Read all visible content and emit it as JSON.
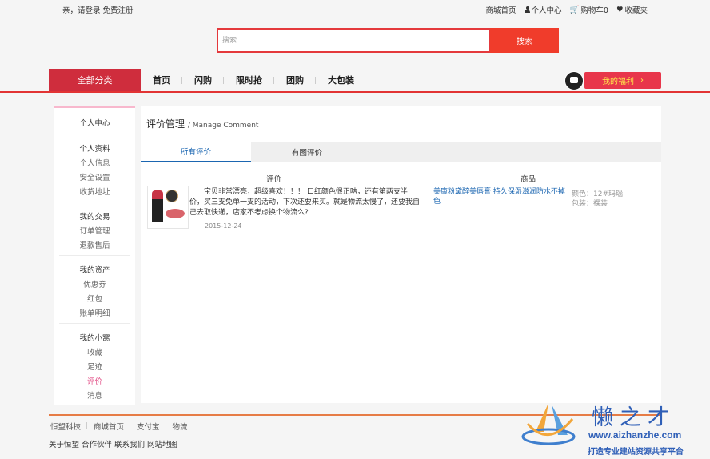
{
  "top": {
    "greeting": "亲，请登录",
    "register": "免费注册",
    "links": [
      "商城首页",
      "个人中心",
      "购物车0",
      "收藏夹"
    ]
  },
  "search": {
    "placeholder": "搜索",
    "button": "搜索"
  },
  "nav": {
    "all_categories": "全部分类",
    "links": [
      "首页",
      "闪购",
      "限时抢",
      "团购",
      "大包装"
    ],
    "welfare": "我的福利"
  },
  "sidebar": {
    "title": "个人中心",
    "groups": [
      {
        "head": "个人资料",
        "items": [
          "个人信息",
          "安全设置",
          "收货地址"
        ]
      },
      {
        "head": "我的交易",
        "items": [
          "订单管理",
          "退款售后"
        ]
      },
      {
        "head": "我的资产",
        "items": [
          "优惠券",
          "红包",
          "账单明细"
        ]
      },
      {
        "head": "我的小窝",
        "items": [
          "收藏",
          "足迹",
          "评价",
          "消息"
        ]
      }
    ],
    "active": "评价"
  },
  "main": {
    "title": "评价管理",
    "subtitle": "/ Manage Comment",
    "tabs": [
      "所有评价",
      "有图评价"
    ],
    "columns": [
      "评价",
      "商品"
    ],
    "comment": {
      "text": "宝贝非常漂亮，超级喜欢！！！ 口红颜色很正呐，还有第两支半价，买三支免单一支的活动，下次还要来买。就是物流太慢了，还要我自己去取快递，店家不考虑换个物流么?",
      "date": "2015-12-24",
      "goods_name": "美康粉黛醉美唇膏 持久保湿滋润防水不掉色",
      "color_attr": "颜色：12#玛瑙",
      "package_attr": "包装：裸装"
    }
  },
  "footer": {
    "links": [
      "恒望科技",
      "商城首页",
      "支付宝",
      "物流"
    ],
    "links2": "关于恒望 合作伙伴 联系我们 网站地图"
  },
  "watermark": {
    "title": "懒之才",
    "url": "www.aizhanzhe.com",
    "slogan": "打造专业建站资源共享平台"
  },
  "colors": {
    "accent": "#e4393c",
    "nav_all_bg": "#cf2d3d",
    "link_blue": "#1b66b1",
    "active_pink": "#e3548a"
  }
}
